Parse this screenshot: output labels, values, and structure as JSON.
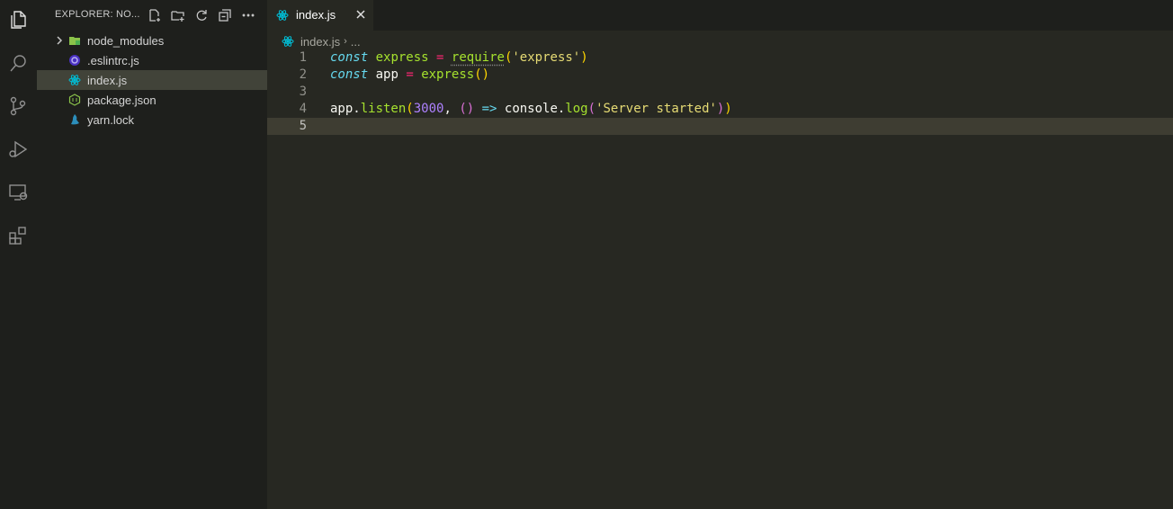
{
  "activity_bar": {
    "items": [
      {
        "name": "explorer",
        "icon": "files-icon",
        "active": true
      },
      {
        "name": "search",
        "icon": "search-icon",
        "active": false
      },
      {
        "name": "source-control",
        "icon": "source-control-icon",
        "active": false
      },
      {
        "name": "run-debug",
        "icon": "run-debug-icon",
        "active": false
      },
      {
        "name": "remote-explorer",
        "icon": "remote-explorer-icon",
        "active": false
      },
      {
        "name": "extensions",
        "icon": "extensions-icon",
        "active": false
      }
    ]
  },
  "sidebar": {
    "title": "EXPLORER: NO...",
    "actions": [
      "new-file-icon",
      "new-folder-icon",
      "refresh-icon",
      "collapse-all-icon",
      "more-actions-icon"
    ],
    "tree": [
      {
        "label": "node_modules",
        "type": "folder",
        "icon": "folder-node-icon",
        "selected": false
      },
      {
        "label": ".eslintrc.js",
        "type": "file",
        "icon": "eslint-icon",
        "selected": false
      },
      {
        "label": "index.js",
        "type": "file",
        "icon": "react-icon",
        "selected": true
      },
      {
        "label": "package.json",
        "type": "file",
        "icon": "nodejs-icon",
        "selected": false
      },
      {
        "label": "yarn.lock",
        "type": "file",
        "icon": "yarn-icon",
        "selected": false
      }
    ]
  },
  "editor": {
    "tab": {
      "title": "index.js",
      "icon": "react-icon",
      "close_icon": "close-icon"
    },
    "breadcrumb": {
      "file": "index.js",
      "more": "..."
    },
    "lines": [
      {
        "number": "1",
        "text": "const express = require('express')"
      },
      {
        "number": "2",
        "text": "const app = express()"
      },
      {
        "number": "3",
        "text": ""
      },
      {
        "number": "4",
        "text": "app.listen(3000, () => console.log('Server started'))"
      },
      {
        "number": "5",
        "text": ""
      }
    ],
    "current_line": 5
  },
  "colors": {
    "background": "#272822",
    "sidebar": "#1e1f1c",
    "keyword": "#66d9ef",
    "operator": "#f92672",
    "function": "#a6e22e",
    "string": "#e6db74",
    "number": "#ae81ff"
  }
}
